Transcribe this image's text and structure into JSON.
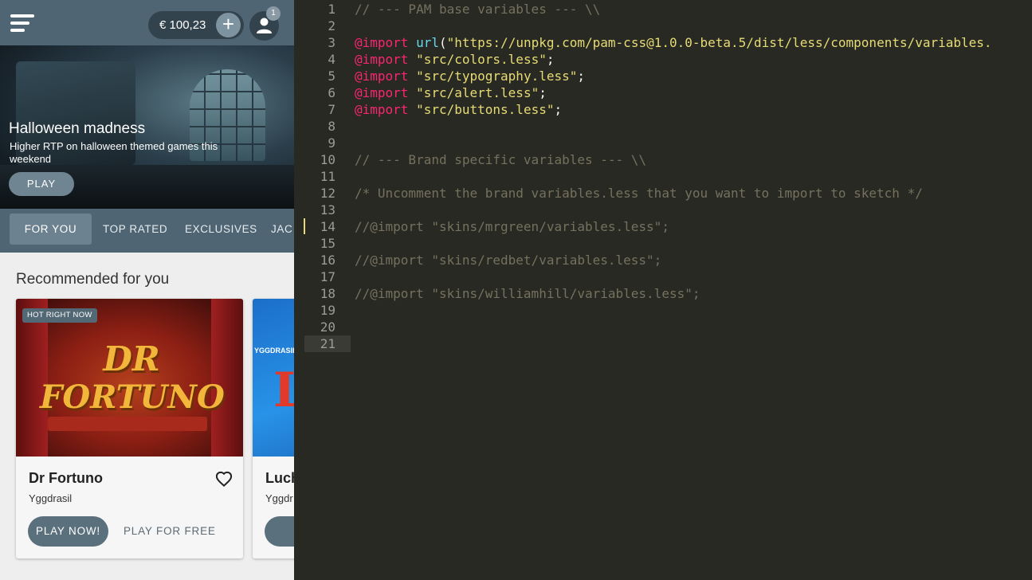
{
  "app": {
    "balance": "€ 100,23",
    "deposit_symbol": "+",
    "notification_count": "1",
    "hero": {
      "title": "Halloween madness",
      "subtitle": "Higher RTP on halloween themed games this weekend",
      "play_label": "PLAY"
    },
    "tabs": [
      {
        "label": "FOR YOU"
      },
      {
        "label": "TOP RATED"
      },
      {
        "label": "EXCLUSIVES"
      },
      {
        "label": "JAC"
      }
    ],
    "section_title": "Recommended for you",
    "games": [
      {
        "badge": "HOT RIGHT NOW",
        "art_line1": "DR",
        "art_line2": "FORTUNO",
        "title": "Dr Fortuno",
        "provider": "Yggdrasil",
        "play_now": "PLAY NOW!",
        "play_free": "PLAY FOR FREE"
      },
      {
        "badge": "",
        "art_text": "L",
        "art_brand": "YGGDRASIL",
        "title": "Luch",
        "provider": "Yggdr",
        "play_now": "PLA"
      }
    ]
  },
  "editor": {
    "lines": [
      {
        "no": "1",
        "parts": [
          {
            "t": "// --- PAM base variables --- \\\\",
            "c": "comment"
          }
        ]
      },
      {
        "no": "2",
        "parts": []
      },
      {
        "no": "3",
        "parts": [
          {
            "t": "@import",
            "c": "at"
          },
          {
            "t": " ",
            "c": "plain"
          },
          {
            "t": "url",
            "c": "fn"
          },
          {
            "t": "(",
            "c": "plain"
          },
          {
            "t": "\"https://unpkg.com/pam-css@1.0.0-beta.5/dist/less/components/variables.",
            "c": "str"
          }
        ]
      },
      {
        "no": "4",
        "parts": [
          {
            "t": "@import",
            "c": "at"
          },
          {
            "t": " ",
            "c": "plain"
          },
          {
            "t": "\"src/colors.less\"",
            "c": "str"
          },
          {
            "t": ";",
            "c": "plain"
          }
        ]
      },
      {
        "no": "5",
        "parts": [
          {
            "t": "@import",
            "c": "at"
          },
          {
            "t": " ",
            "c": "plain"
          },
          {
            "t": "\"src/typography.less\"",
            "c": "str"
          },
          {
            "t": ";",
            "c": "plain"
          }
        ]
      },
      {
        "no": "6",
        "parts": [
          {
            "t": "@import",
            "c": "at"
          },
          {
            "t": " ",
            "c": "plain"
          },
          {
            "t": "\"src/alert.less\"",
            "c": "str"
          },
          {
            "t": ";",
            "c": "plain"
          }
        ]
      },
      {
        "no": "7",
        "parts": [
          {
            "t": "@import",
            "c": "at"
          },
          {
            "t": " ",
            "c": "plain"
          },
          {
            "t": "\"src/buttons.less\"",
            "c": "str"
          },
          {
            "t": ";",
            "c": "plain"
          }
        ]
      },
      {
        "no": "8",
        "parts": []
      },
      {
        "no": "9",
        "parts": []
      },
      {
        "no": "10",
        "parts": [
          {
            "t": "// --- Brand specific variables --- \\\\",
            "c": "comment"
          }
        ]
      },
      {
        "no": "11",
        "parts": []
      },
      {
        "no": "12",
        "parts": [
          {
            "t": "/* Uncomment the brand variables.less that you want to import to sketch */",
            "c": "comment"
          }
        ]
      },
      {
        "no": "13",
        "parts": []
      },
      {
        "no": "14",
        "parts": [
          {
            "t": "//@import \"skins/mrgreen/variables.less\";",
            "c": "comment"
          }
        ]
      },
      {
        "no": "15",
        "parts": []
      },
      {
        "no": "16",
        "parts": [
          {
            "t": "//@import \"skins/redbet/variables.less\";",
            "c": "comment"
          }
        ]
      },
      {
        "no": "17",
        "parts": []
      },
      {
        "no": "18",
        "parts": [
          {
            "t": "//@import \"skins/williamhill/variables.less\";",
            "c": "comment"
          }
        ]
      },
      {
        "no": "19",
        "parts": []
      },
      {
        "no": "20",
        "parts": []
      },
      {
        "no": "21",
        "parts": []
      }
    ],
    "active_line": "21",
    "modified_line": "14"
  },
  "colors": {
    "brand_bar": "#4f6574",
    "editor_bg": "#282923",
    "syntax_comment": "#75715e",
    "syntax_keyword": "#f92672",
    "syntax_function": "#66d9ef",
    "syntax_string": "#e6db74"
  }
}
